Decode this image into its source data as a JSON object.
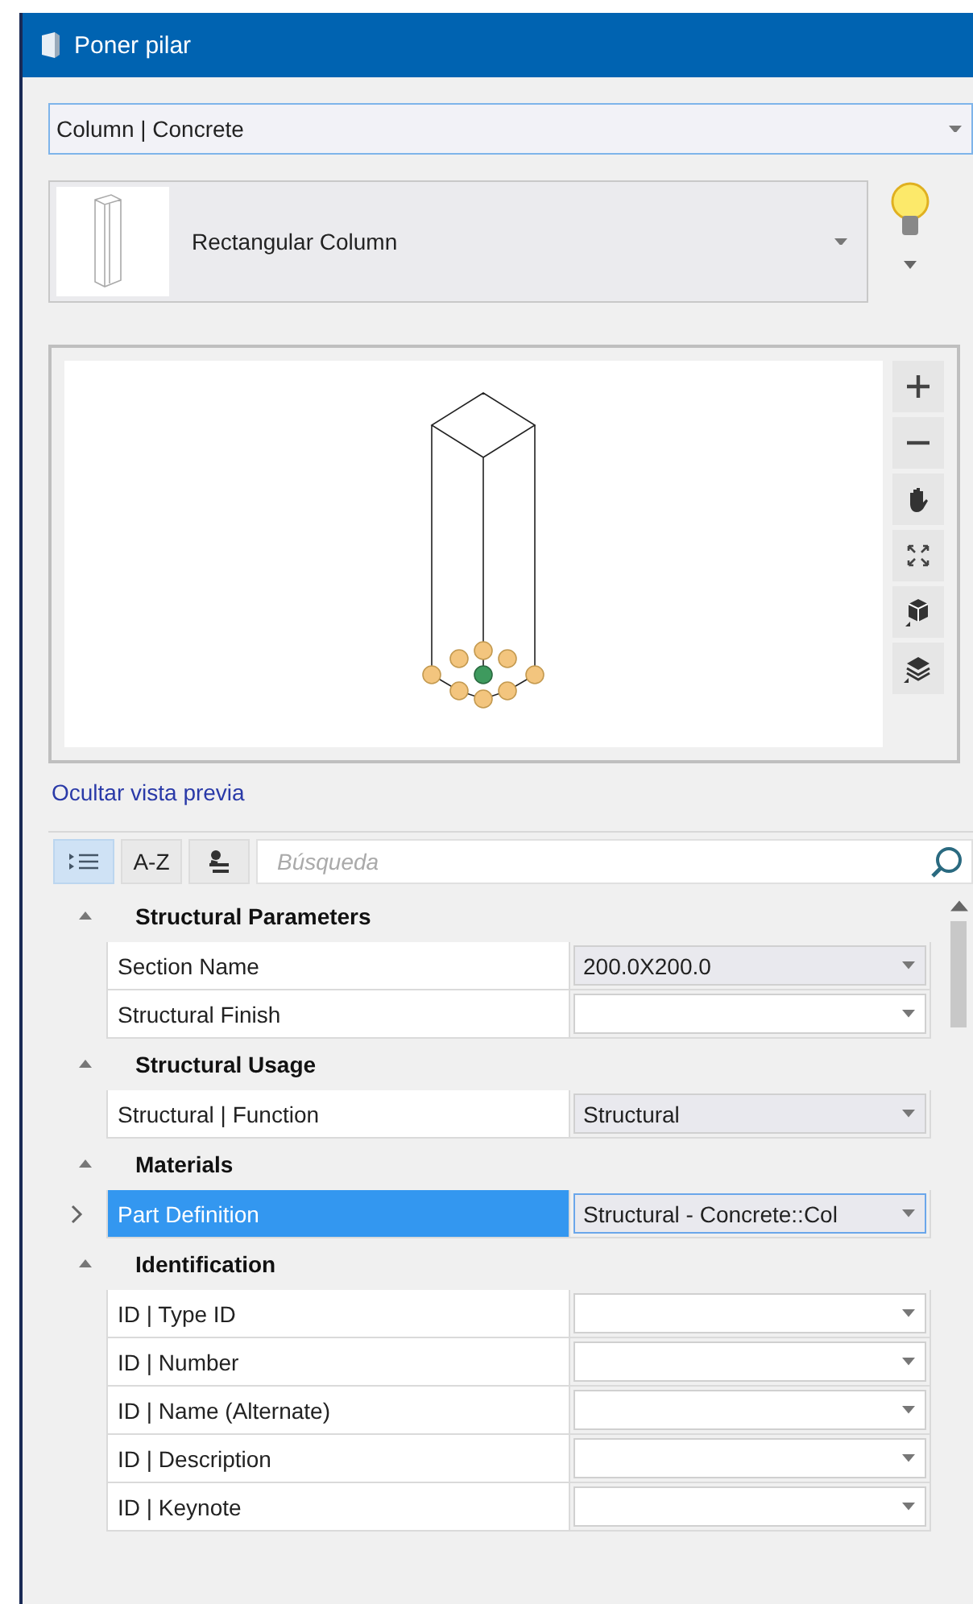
{
  "window": {
    "title": "Poner pilar"
  },
  "category_combo": {
    "value": "Column | Concrete"
  },
  "type_selector": {
    "value": "Rectangular Column"
  },
  "preview": {
    "tools": [
      {
        "kind": "zoom-in"
      },
      {
        "kind": "zoom-out"
      },
      {
        "kind": "pan"
      },
      {
        "kind": "fit"
      },
      {
        "kind": "view"
      },
      {
        "kind": "layers"
      }
    ],
    "hide_link": "Ocultar vista previa"
  },
  "property_toolbar": {
    "modes": [
      {
        "kind": "categorized",
        "selected": true
      },
      {
        "kind": "alphabetical",
        "label": "A-Z",
        "selected": false
      },
      {
        "kind": "custom",
        "selected": false
      }
    ],
    "search": {
      "placeholder": "Búsqueda"
    }
  },
  "property_groups": [
    {
      "title": "Structural Parameters",
      "expanded": true,
      "properties": [
        {
          "name": "Section Name",
          "value": "200.0X200.0",
          "selected": false,
          "expandable": false
        },
        {
          "name": "Structural Finish",
          "selected": false,
          "expandable": false
        }
      ]
    },
    {
      "title": "Structural Usage",
      "expanded": true,
      "properties": [
        {
          "name": "Structural | Function",
          "value": "Structural",
          "selected": false,
          "expandable": false
        }
      ]
    },
    {
      "title": "Materials",
      "expanded": true,
      "properties": [
        {
          "name": "Part Definition",
          "value": "Structural - Concrete::Col",
          "selected": true,
          "expandable": true
        }
      ]
    },
    {
      "title": "Identification",
      "expanded": true,
      "properties": [
        {
          "name": "ID | Type ID",
          "selected": false,
          "expandable": false
        },
        {
          "name": "ID | Number",
          "selected": false,
          "expandable": false
        },
        {
          "name": "ID | Name (Alternate)",
          "selected": false,
          "expandable": false
        },
        {
          "name": "ID | Description",
          "selected": false,
          "expandable": false
        },
        {
          "name": "ID | Keynote",
          "selected": false,
          "expandable": false
        }
      ]
    }
  ]
}
